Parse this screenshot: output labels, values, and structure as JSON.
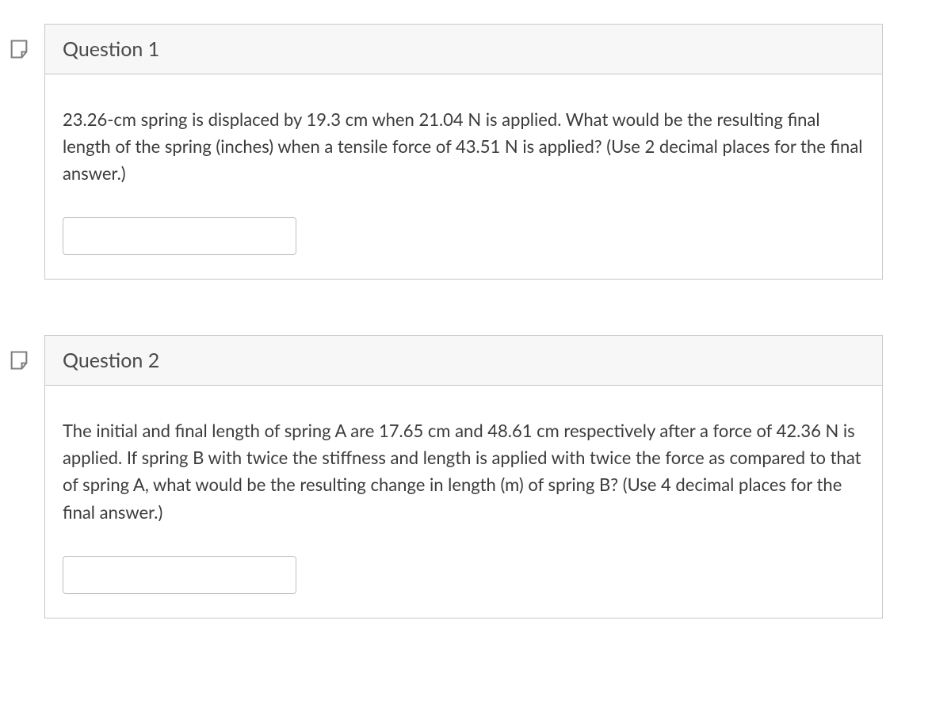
{
  "questions": [
    {
      "title": "Question 1",
      "meta": " ",
      "body": "23.26-cm spring is displaced by 19.3 cm when 21.04 N is applied. What would be the resulting final length of the spring (inches) when a tensile force of 43.51 N is applied? (Use 2 decimal places for the final answer.)",
      "answer": ""
    },
    {
      "title": "Question 2",
      "meta": " ",
      "body": "The initial and final length of spring A are 17.65 cm and 48.61 cm respectively after a force of 42.36 N is applied. If spring B with twice the stiffness and length is applied with twice the force as compared to that of spring A, what would be the resulting change in length (m) of spring B? (Use 4 decimal places for the final answer.)",
      "answer": ""
    }
  ]
}
